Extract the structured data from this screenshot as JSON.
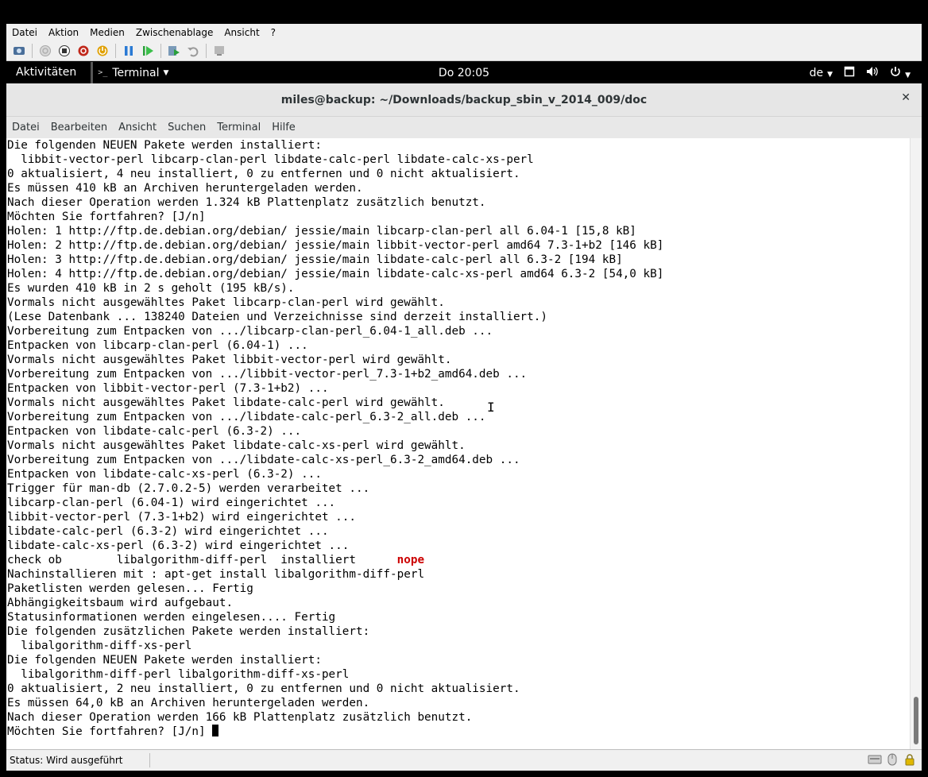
{
  "vm": {
    "menu": [
      "Datei",
      "Aktion",
      "Medien",
      "Zwischenablage",
      "Ansicht",
      "?"
    ],
    "toolbar_icons": [
      "ctrl-alt-del-icon",
      "start-icon",
      "turn-off-icon",
      "shutdown-icon",
      "power-icon",
      "pause-icon",
      "resume-icon",
      "checkpoint-icon",
      "revert-icon",
      "enhanced-session-icon"
    ],
    "status": "Status: Wird ausgeführt"
  },
  "gnome": {
    "activities": "Aktivitäten",
    "app_menu": "Terminal",
    "clock": "Do 20:05",
    "input_source": "de"
  },
  "terminal": {
    "title": "miles@backup: ~/Downloads/backup_sbin_v_2014_009/doc",
    "menu": [
      "Datei",
      "Bearbeiten",
      "Ansicht",
      "Suchen",
      "Terminal",
      "Hilfe"
    ],
    "lines": [
      "Die folgenden NEUEN Pakete werden installiert:",
      "  libbit-vector-perl libcarp-clan-perl libdate-calc-perl libdate-calc-xs-perl",
      "0 aktualisiert, 4 neu installiert, 0 zu entfernen und 0 nicht aktualisiert.",
      "Es müssen 410 kB an Archiven heruntergeladen werden.",
      "Nach dieser Operation werden 1.324 kB Plattenplatz zusätzlich benutzt.",
      "Möchten Sie fortfahren? [J/n]",
      "Holen: 1 http://ftp.de.debian.org/debian/ jessie/main libcarp-clan-perl all 6.04-1 [15,8 kB]",
      "Holen: 2 http://ftp.de.debian.org/debian/ jessie/main libbit-vector-perl amd64 7.3-1+b2 [146 kB]",
      "Holen: 3 http://ftp.de.debian.org/debian/ jessie/main libdate-calc-perl all 6.3-2 [194 kB]",
      "Holen: 4 http://ftp.de.debian.org/debian/ jessie/main libdate-calc-xs-perl amd64 6.3-2 [54,0 kB]",
      "Es wurden 410 kB in 2 s geholt (195 kB/s).",
      "Vormals nicht ausgewähltes Paket libcarp-clan-perl wird gewählt.",
      "(Lese Datenbank ... 138240 Dateien und Verzeichnisse sind derzeit installiert.)",
      "Vorbereitung zum Entpacken von .../libcarp-clan-perl_6.04-1_all.deb ...",
      "Entpacken von libcarp-clan-perl (6.04-1) ...",
      "Vormals nicht ausgewähltes Paket libbit-vector-perl wird gewählt.",
      "Vorbereitung zum Entpacken von .../libbit-vector-perl_7.3-1+b2_amd64.deb ...",
      "Entpacken von libbit-vector-perl (7.3-1+b2) ...",
      "Vormals nicht ausgewähltes Paket libdate-calc-perl wird gewählt.",
      "Vorbereitung zum Entpacken von .../libdate-calc-perl_6.3-2_all.deb ...",
      "Entpacken von libdate-calc-perl (6.3-2) ...",
      "Vormals nicht ausgewähltes Paket libdate-calc-xs-perl wird gewählt.",
      "Vorbereitung zum Entpacken von .../libdate-calc-xs-perl_6.3-2_amd64.deb ...",
      "Entpacken von libdate-calc-xs-perl (6.3-2) ...",
      "Trigger für man-db (2.7.0.2-5) werden verarbeitet ...",
      "libcarp-clan-perl (6.04-1) wird eingerichtet ...",
      "libbit-vector-perl (7.3-1+b2) wird eingerichtet ...",
      "libdate-calc-perl (6.3-2) wird eingerichtet ...",
      "libdate-calc-xs-perl (6.3-2) wird eingerichtet ...",
      "CHECK_LINE",
      "Nachinstallieren mit : apt-get install libalgorithm-diff-perl",
      "Paketlisten werden gelesen... Fertig",
      "Abhängigkeitsbaum wird aufgebaut.",
      "Statusinformationen werden eingelesen.... Fertig",
      "Die folgenden zusätzlichen Pakete werden installiert:",
      "  libalgorithm-diff-xs-perl",
      "Die folgenden NEUEN Pakete werden installiert:",
      "  libalgorithm-diff-perl libalgorithm-diff-xs-perl",
      "0 aktualisiert, 2 neu installiert, 0 zu entfernen und 0 nicht aktualisiert.",
      "Es müssen 64,0 kB an Archiven heruntergeladen werden.",
      "Nach dieser Operation werden 166 kB Plattenplatz zusätzlich benutzt.",
      "PROMPT_LINE"
    ],
    "check_line": {
      "prefix": "check ob        libalgorithm-diff-perl  installiert      ",
      "result": "nope"
    },
    "prompt": "Möchten Sie fortfahren? [J/n] ",
    "colors": {
      "nope": "#cc0000",
      "background": "#ffffff",
      "text": "#000000"
    }
  }
}
